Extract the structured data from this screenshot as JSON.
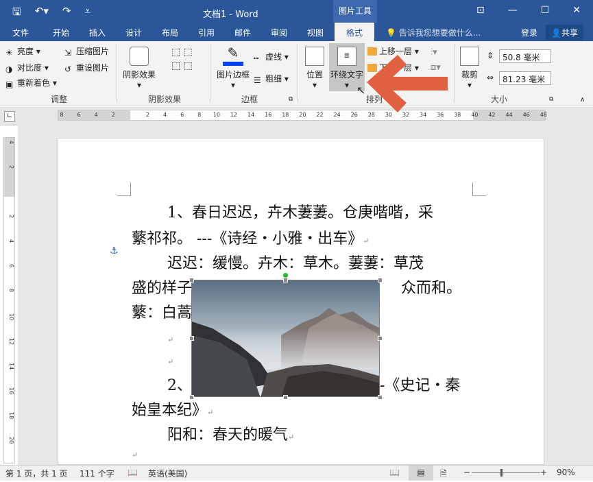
{
  "titlebar": {
    "title": "文档1 - Word",
    "context_group": "图片工具"
  },
  "menu": {
    "tabs": [
      "文件",
      "开始",
      "插入",
      "设计",
      "布局",
      "引用",
      "邮件",
      "审阅",
      "视图",
      "格式"
    ],
    "tell_me": "告诉我您想要做什么...",
    "login": "登录",
    "share": "共享"
  },
  "ribbon": {
    "adjust": {
      "brightness": "亮度",
      "contrast": "对比度",
      "recolor": "重新着色",
      "compress": "压缩图片",
      "reset": "重设图片",
      "group": "调整"
    },
    "shadow": {
      "effects": "阴影效果",
      "group": "阴影效果"
    },
    "border": {
      "picture_border": "图片边框",
      "dash": "虚线",
      "weight": "粗细",
      "group": "边框"
    },
    "arrange": {
      "position": "位置",
      "wrap_text": "环绕文字",
      "bring_forward": "上移一层",
      "send_backward": "下移一层",
      "group": "排列"
    },
    "size": {
      "crop": "裁剪",
      "height": "50.8 毫米",
      "width": "81.23 毫米",
      "group": "大小"
    }
  },
  "ruler": {
    "numbers": [
      "8",
      "6",
      "4",
      "2",
      "",
      "2",
      "4",
      "6",
      "8",
      "10",
      "12",
      "14",
      "16",
      "18",
      "20",
      "22",
      "24",
      "26",
      "28",
      "30",
      "32",
      "34",
      "36",
      "38",
      "40",
      "42",
      "44",
      "46",
      "48"
    ]
  },
  "document": {
    "line1": "1、春日迟迟，卉木萋萋。仓庚喈喈，采",
    "line2": "蘩祁祁。 ---《诗经・小雅・出车》",
    "line3": "迟迟：缓慢。卉木：草木。萋萋：草茂",
    "line4a": "盛的样子",
    "line4b": "众而和。",
    "line5": "蘩：白蒿",
    "line6a": "2、",
    "line6b": "-《史记・秦",
    "line7": "始皇本纪》",
    "line8": "阳和：春天的暖气"
  },
  "status": {
    "page": "第 1 页，共 1 页",
    "words": "111 个字",
    "lang": "英语(美国)",
    "zoom": "90%"
  },
  "colors": {
    "accent": "#2b579a",
    "arrow": "#e0603f"
  }
}
